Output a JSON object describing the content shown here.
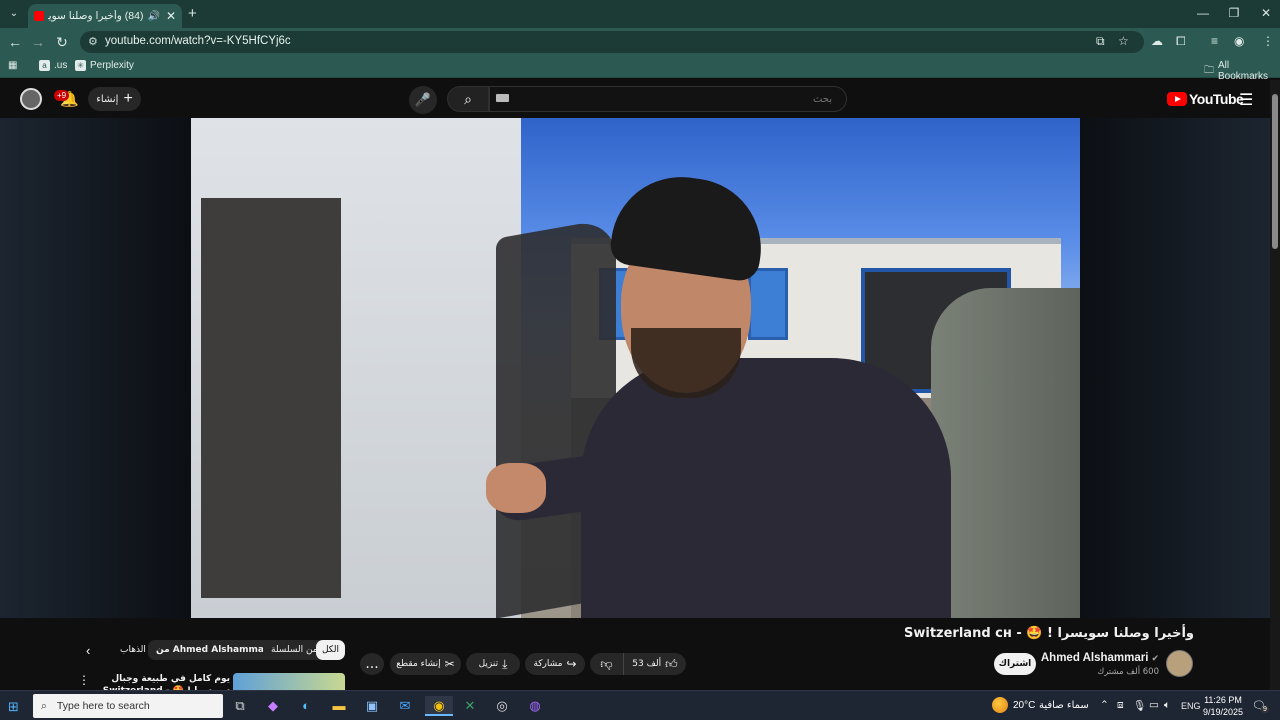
{
  "browser": {
    "tab_title": "(84) وأخيرا وصلنا سويسرا",
    "tab_close": "✕",
    "new_tab": "+",
    "url": "youtube.com/watch?v=-KY5HfCYj6c",
    "bookmarks": [
      {
        "label": ".us",
        "icon": "amazon-icon"
      },
      {
        "label": "Perplexity",
        "icon": "perplexity-icon"
      }
    ],
    "all_bookmarks": "All Bookmarks"
  },
  "youtube": {
    "create_label": "إنشاء",
    "notif_badge": "+9",
    "search_placeholder": "بحث",
    "logo_text": "YouTube",
    "video_title": "وأخيرا وصلنا سويسرا ! 🤩 - Switzerland ᴄʜ",
    "channel_name": "Ahmed Alshammari",
    "subscribers": "600 ألف مشترك",
    "subscribe_label": "اشتراك",
    "like_count": "53 ألف",
    "share_label": "مشاركة",
    "download_label": "تنزيل",
    "clip_label": "إنشاء مقطع",
    "more_label": "...",
    "chips": {
      "all": "الكل",
      "series": "من السلسلة",
      "from_channel": "من Ahmed Alshammari",
      "travel": "الذهاب"
    },
    "rec_title": "يوم كامل في طبيعة وجبال سويسرا ! 🤩 - Switzerland ᴄʜ"
  },
  "taskbar": {
    "search_placeholder": "Type here to search",
    "weather_temp": "20°C",
    "weather_desc": "سماء صافية",
    "lang": "ENG",
    "time": "11:26 PM",
    "date": "9/19/2025",
    "notif_count": "9"
  }
}
